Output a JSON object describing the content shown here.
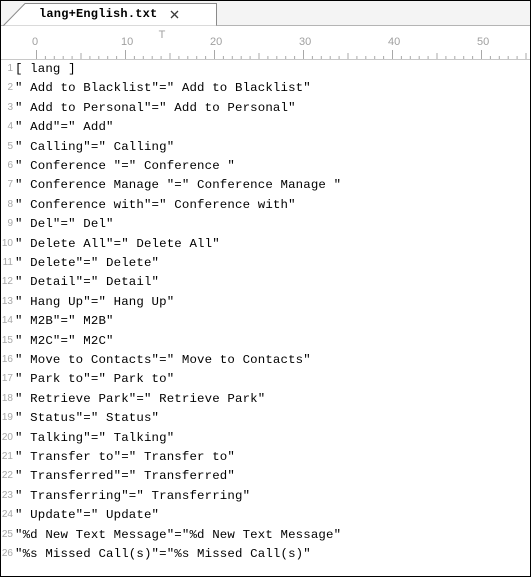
{
  "tab": {
    "title": "lang+English.txt",
    "close_icon": "close-icon"
  },
  "ruler": {
    "labels": [
      "0",
      "10",
      "20",
      "30",
      "40",
      "50"
    ],
    "cursor_marker": "T"
  },
  "editor": {
    "lines": [
      {
        "num": "1",
        "text": "[ lang ]"
      },
      {
        "num": "2",
        "text": "\" Add to Blacklist\"=\" Add to Blacklist\""
      },
      {
        "num": "3",
        "text": "\" Add to Personal\"=\" Add to Personal\""
      },
      {
        "num": "4",
        "text": "\" Add\"=\" Add\""
      },
      {
        "num": "5",
        "text": "\" Calling\"=\" Calling\""
      },
      {
        "num": "6",
        "text": "\" Conference \"=\" Conference \""
      },
      {
        "num": "7",
        "text": "\" Conference Manage \"=\" Conference Manage \""
      },
      {
        "num": "8",
        "text": "\" Conference with\"=\" Conference with\""
      },
      {
        "num": "9",
        "text": "\" Del\"=\" Del\""
      },
      {
        "num": "10",
        "text": "\" Delete All\"=\" Delete All\""
      },
      {
        "num": "11",
        "text": "\" Delete\"=\" Delete\""
      },
      {
        "num": "12",
        "text": "\" Detail\"=\" Detail\""
      },
      {
        "num": "13",
        "text": "\" Hang Up\"=\" Hang Up\""
      },
      {
        "num": "14",
        "text": "\" M2B\"=\" M2B\""
      },
      {
        "num": "15",
        "text": "\" M2C\"=\" M2C\""
      },
      {
        "num": "16",
        "text": "\" Move to Contacts\"=\" Move to Contacts\""
      },
      {
        "num": "17",
        "text": "\" Park to\"=\" Park to\""
      },
      {
        "num": "18",
        "text": "\" Retrieve Park\"=\" Retrieve Park\""
      },
      {
        "num": "19",
        "text": "\" Status\"=\" Status\""
      },
      {
        "num": "20",
        "text": "\" Talking\"=\" Talking\""
      },
      {
        "num": "21",
        "text": "\" Transfer to\"=\" Transfer to\""
      },
      {
        "num": "22",
        "text": "\" Transferred\"=\" Transferred\""
      },
      {
        "num": "23",
        "text": "\" Transferring\"=\" Transferring\""
      },
      {
        "num": "24",
        "text": "\" Update\"=\" Update\""
      },
      {
        "num": "25",
        "text": "\"%d New Text Message\"=\"%d New Text Message\""
      },
      {
        "num": "26",
        "text": "\"%s Missed Call(s)\"=\"%s Missed Call(s)\""
      }
    ]
  }
}
